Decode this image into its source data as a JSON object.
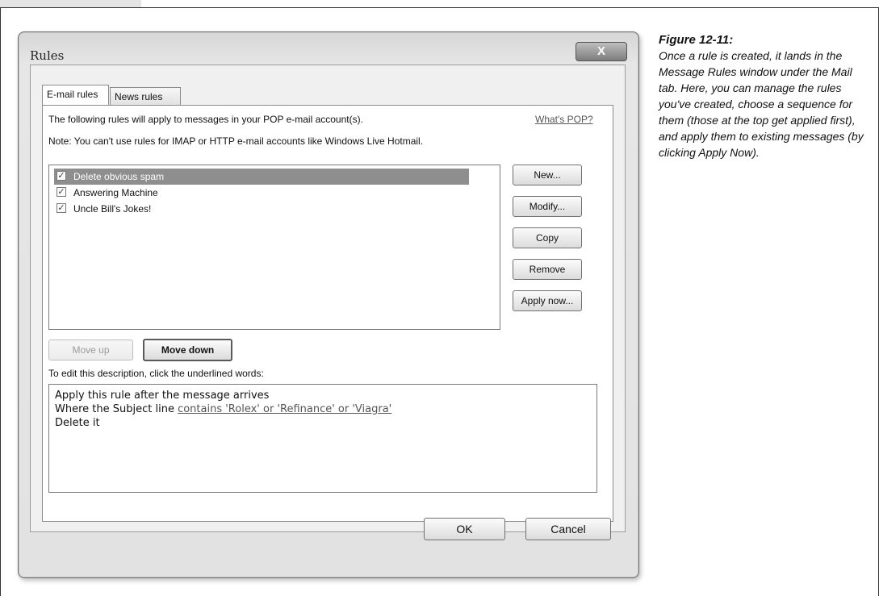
{
  "window": {
    "title": "Rules",
    "close_glyph": "X"
  },
  "tabs": [
    {
      "label": "E-mail rules",
      "active": true
    },
    {
      "label": "News rules",
      "active": false
    }
  ],
  "info": {
    "pop_text": "The following rules will apply to messages in your POP e-mail account(s).",
    "pop_link": "What's POP?",
    "note_text": "Note: You can't use rules for IMAP or HTTP e-mail accounts like Windows Live Hotmail."
  },
  "rules": [
    {
      "label": "Delete obvious spam",
      "checked": true,
      "selected": true
    },
    {
      "label": "Answering Machine",
      "checked": true,
      "selected": false
    },
    {
      "label": "Uncle Bill's Jokes!",
      "checked": true,
      "selected": false
    }
  ],
  "side_buttons": {
    "new": "New...",
    "modify": "Modify...",
    "copy": "Copy",
    "remove": "Remove",
    "apply_now": "Apply now..."
  },
  "move": {
    "up": "Move up",
    "down": "Move down"
  },
  "description": {
    "label": "To edit this description, click the underlined words:",
    "line1": "Apply this rule after the message arrives",
    "line2_prefix": "Where the Subject line ",
    "line2_link": "contains 'Rolex' or 'Refinance' or 'Viagra'",
    "line3": "Delete it"
  },
  "footer": {
    "ok": "OK",
    "cancel": "Cancel"
  },
  "caption": {
    "title": "Figure 12-11:",
    "body": "Once a rule is created, it lands in the Message Rules window under the Mail tab. Here, you can manage the rules you've created, choose a sequence for them (those at the top get applied first), and apply them to existing messages (by clicking Apply Now)."
  },
  "colors": {
    "selection": "#8e8e8e",
    "window_frame": "#e2e2e2",
    "link": "#555555"
  }
}
